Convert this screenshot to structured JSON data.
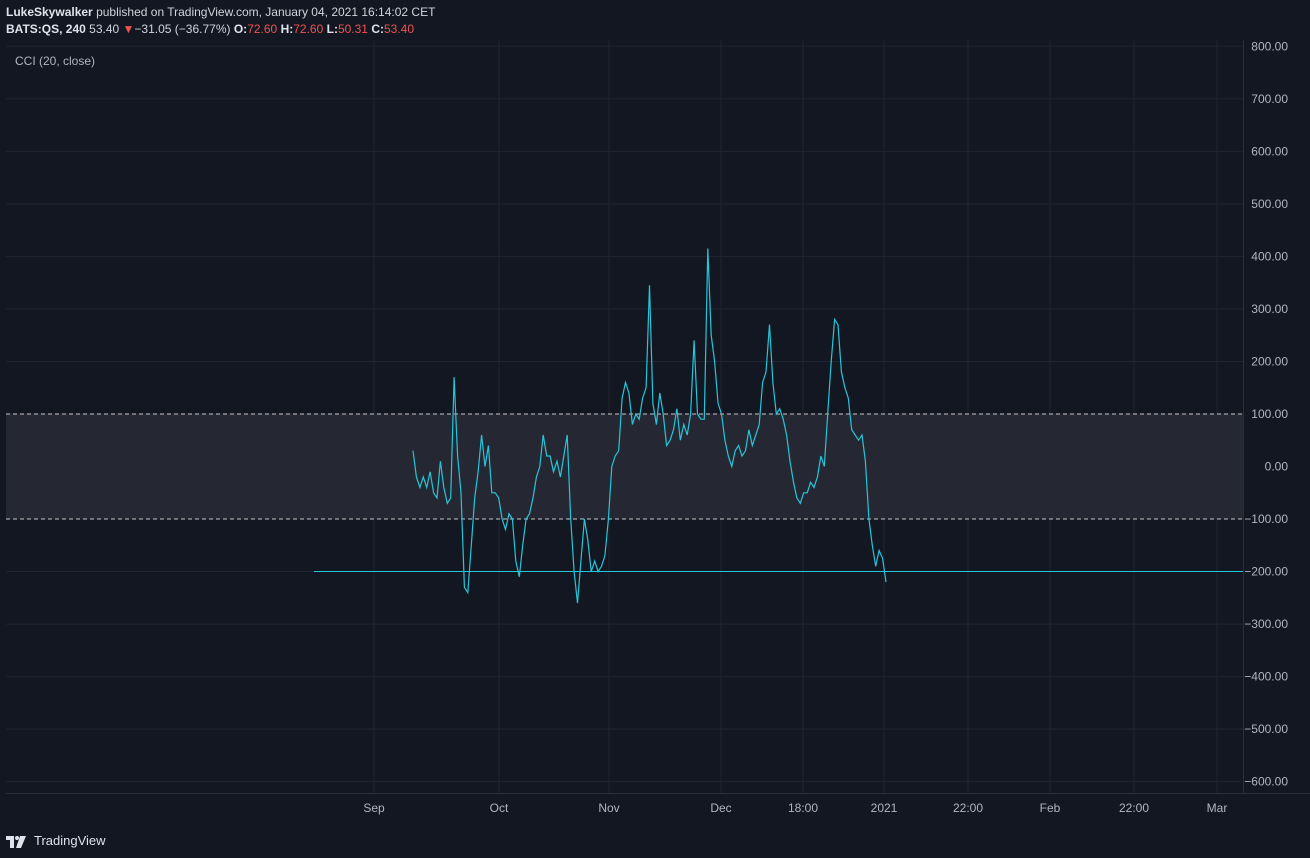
{
  "header": {
    "author": "LukeSkywalker",
    "published": "published on TradingView.com, January 04, 2021 16:14:02 CET",
    "symbol": "BATS:QS, 240",
    "last": "53.40",
    "change_arrow": "▼",
    "change": "−31.05 (−36.77%)",
    "o_label": "O:",
    "o_value": "72.60",
    "h_label": "H:",
    "h_value": "72.60",
    "l_label": "L:",
    "l_value": "50.31",
    "c_label": "C:",
    "c_value": "53.40"
  },
  "indicator_label": "CCI (20, close)",
  "footer": {
    "brand": "TradingView"
  },
  "colors": {
    "background": "#131722",
    "line": "#26c6da",
    "band": "#252733",
    "grid": "#1f2430",
    "negative": "#ef5350"
  },
  "chart_data": {
    "type": "line",
    "ylim": [
      -620,
      820
    ],
    "y_ticks": [
      800,
      700,
      600,
      500,
      400,
      300,
      200,
      100,
      0,
      -100,
      -200,
      -300,
      -400,
      -500,
      -600
    ],
    "y_tick_labels": [
      "800.00",
      "700.00",
      "600.00",
      "500.00",
      "400.00",
      "300.00",
      "200.00",
      "100.00",
      "0.00",
      "−100.00",
      "−200.00",
      "−300.00",
      "−400.00",
      "−500.00",
      "−600.00"
    ],
    "x_labels": [
      "Sep",
      "Oct",
      "Nov",
      "Dec",
      "18:00",
      "2021",
      "22:00",
      "Feb",
      "22:00",
      "Mar"
    ],
    "upper_band": 100,
    "lower_band": -100,
    "horizontal_line": -200,
    "series": [
      {
        "values": [
          30,
          -20,
          -40,
          -20,
          -40,
          -10,
          -50,
          -60,
          10,
          -40,
          -70,
          -60,
          170,
          20,
          -50,
          -230,
          -240,
          -150,
          -60,
          -10,
          60,
          0,
          40,
          -50,
          -50,
          -60,
          -100,
          -120,
          -90,
          -100,
          -180,
          -210,
          -150,
          -100,
          -90,
          -60,
          -20,
          0,
          60,
          20,
          20,
          -10,
          10,
          -20,
          20,
          60,
          -100,
          -200,
          -260,
          -180,
          -100,
          -140,
          -200,
          -180,
          -200,
          -190,
          -170,
          -100,
          0,
          20,
          30,
          130,
          160,
          140,
          80,
          100,
          90,
          130,
          150,
          345,
          120,
          80,
          140,
          100,
          40,
          50,
          70,
          110,
          50,
          80,
          60,
          100,
          240,
          100,
          90,
          90,
          415,
          250,
          200,
          120,
          100,
          50,
          20,
          0,
          30,
          40,
          20,
          30,
          70,
          40,
          60,
          80,
          160,
          180,
          270,
          160,
          100,
          110,
          90,
          60,
          10,
          -30,
          -60,
          -70,
          -50,
          -50,
          -30,
          -40,
          -20,
          20,
          0,
          100,
          200,
          280,
          270,
          180,
          150,
          130,
          70,
          60,
          50,
          60,
          10,
          -100,
          -150,
          -190,
          -160,
          -175,
          -220
        ]
      }
    ]
  }
}
